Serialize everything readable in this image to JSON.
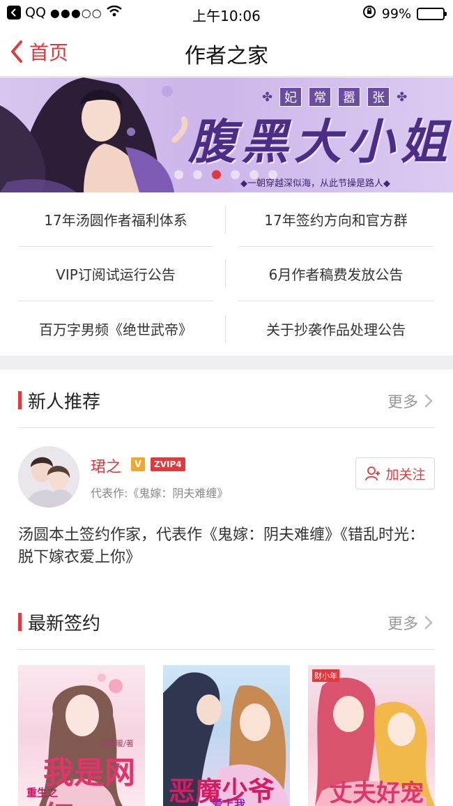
{
  "status_bar": {
    "app_name": "QQ",
    "signal": "●●●○○",
    "time": "上午10:06",
    "battery": "99%"
  },
  "nav": {
    "back_label": "首页",
    "title": "作者之家"
  },
  "banner": {
    "tags": [
      "妃",
      "常",
      "嚣",
      "张"
    ],
    "title": "腹黑大小姐",
    "slogan": "◆一朝穿越深似海，从此节操是路人◆",
    "active_dot": 3,
    "dot_count": 6
  },
  "notices": [
    {
      "label": "17年汤圆作者福利体系"
    },
    {
      "label": "17年签约方向和官方群"
    },
    {
      "label": "VIP订阅试运行公告"
    },
    {
      "label": "6月作者稿费发放公告"
    },
    {
      "label": "百万字男频《绝世武帝》"
    },
    {
      "label": "关于抄袭作品处理公告"
    }
  ],
  "new_recommend": {
    "heading": "新人推荐",
    "more": "更多",
    "author": {
      "name": "珺之",
      "v_badge": "V",
      "vip_badge": "ZVIP4",
      "representative": "代表作:《鬼嫁：阴夫难缠》",
      "follow_label": "加关注",
      "bio": "汤圆本土签约作家，代表作《鬼嫁：阴夫难缠》《错乱时光：脱下嫁衣爱上你》"
    }
  },
  "latest_signed": {
    "heading": "最新签约",
    "more": "更多",
    "covers": [
      {
        "title_art": "我是网红",
        "sub": "重生之",
        "author": "慕暖暖/著"
      },
      {
        "title_art": "恶魔少爷",
        "sub": "爱上我"
      },
      {
        "title_art": "丈夫好宠",
        "sub": "财小年"
      }
    ]
  },
  "colors": {
    "accent": "#e0393e",
    "banner_purple": "#4b2d86",
    "gray_text": "#999999"
  }
}
